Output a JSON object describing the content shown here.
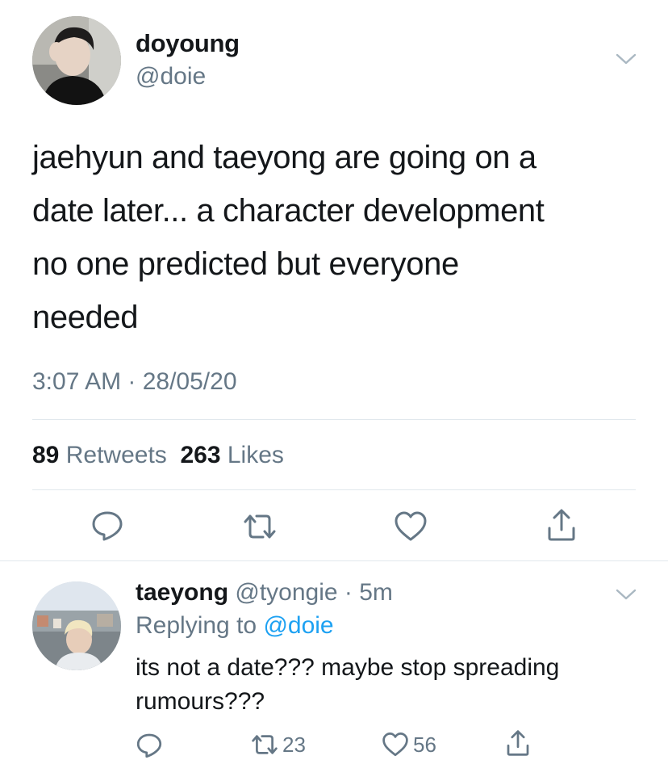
{
  "main_tweet": {
    "display_name": "doyoung",
    "handle": "@doie",
    "text": "jaehyun and taeyong are going on a\ndate later... a character development\nno one predicted but everyone\nneeded",
    "timestamp": "3:07 AM · 28/05/20",
    "retweets_count": "89",
    "retweets_label": "Retweets",
    "likes_count": "263",
    "likes_label": "Likes"
  },
  "reply_tweet": {
    "display_name": "taeyong",
    "meta": "@tyongie · 5m",
    "replying_prefix": "Replying to",
    "replying_to": "@doie",
    "text": "its not a date??? maybe stop spreading\nrumours???",
    "retweet_count": "23",
    "like_count": "56"
  },
  "icons": {
    "reply": "reply-icon",
    "retweet": "retweet-icon",
    "like": "heart-icon",
    "share": "share-icon",
    "menu": "chevron-down-icon"
  },
  "colors": {
    "text_primary": "#14171a",
    "text_secondary": "#657786",
    "link": "#1da1f2",
    "divider": "#e1e8ed",
    "background": "#ffffff"
  }
}
